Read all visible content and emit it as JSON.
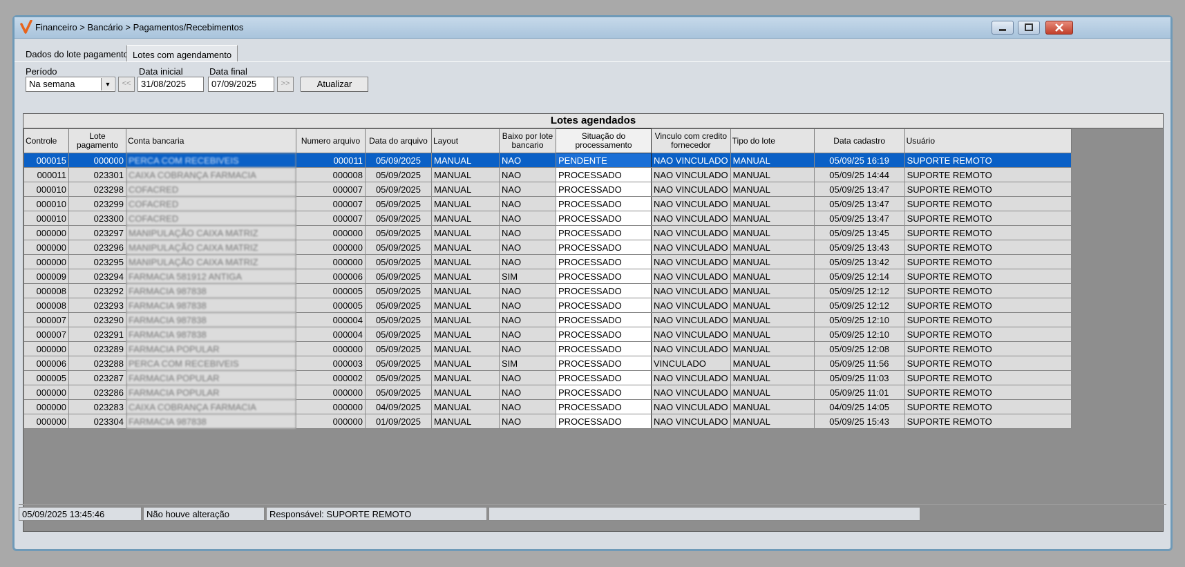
{
  "window": {
    "title": "Financeiro > Bancário > Pagamentos/Recebimentos"
  },
  "tabs": [
    {
      "label": "Dados do lote pagamento"
    },
    {
      "label": "Lotes com agendamento"
    }
  ],
  "filters": {
    "periodo_label": "Período",
    "periodo_value": "Na semana",
    "data_inicial_label": "Data inicial",
    "data_inicial_value": "31/08/2025",
    "data_final_label": "Data final",
    "data_final_value": "07/09/2025",
    "prev_label": "<<",
    "next_label": ">>",
    "atualizar_label": "Atualizar"
  },
  "grid": {
    "caption": "Lotes agendados",
    "columns": [
      "Controle",
      "Lote pagamento",
      "Conta bancaria",
      "Numero arquivo",
      "Data do arquivo",
      "Layout",
      "Baixo por lote bancario",
      "Situação do processamento",
      "Vinculo com credito fornecedor",
      "Tipo do lote",
      "Data cadastro",
      "Usuário"
    ],
    "rows": [
      [
        "000015",
        "000000",
        "PERCA COM RECEBIVEIS",
        "000011",
        "05/09/2025",
        "MANUAL",
        "NAO",
        "PENDENTE",
        "NAO VINCULADO",
        "MANUAL",
        "05/09/25 16:19",
        "SUPORTE REMOTO"
      ],
      [
        "000011",
        "023301",
        "CAIXA COBRANÇA FARMACIA",
        "000008",
        "05/09/2025",
        "MANUAL",
        "NAO",
        "PROCESSADO",
        "NAO VINCULADO",
        "MANUAL",
        "05/09/25 14:44",
        "SUPORTE REMOTO"
      ],
      [
        "000010",
        "023298",
        "COFACRED",
        "000007",
        "05/09/2025",
        "MANUAL",
        "NAO",
        "PROCESSADO",
        "NAO VINCULADO",
        "MANUAL",
        "05/09/25 13:47",
        "SUPORTE REMOTO"
      ],
      [
        "000010",
        "023299",
        "COFACRED",
        "000007",
        "05/09/2025",
        "MANUAL",
        "NAO",
        "PROCESSADO",
        "NAO VINCULADO",
        "MANUAL",
        "05/09/25 13:47",
        "SUPORTE REMOTO"
      ],
      [
        "000010",
        "023300",
        "COFACRED",
        "000007",
        "05/09/2025",
        "MANUAL",
        "NAO",
        "PROCESSADO",
        "NAO VINCULADO",
        "MANUAL",
        "05/09/25 13:47",
        "SUPORTE REMOTO"
      ],
      [
        "000000",
        "023297",
        "MANIPULAÇÃO CAIXA MATRIZ",
        "000000",
        "05/09/2025",
        "MANUAL",
        "NAO",
        "PROCESSADO",
        "NAO VINCULADO",
        "MANUAL",
        "05/09/25 13:45",
        "SUPORTE REMOTO"
      ],
      [
        "000000",
        "023296",
        "MANIPULAÇÃO CAIXA MATRIZ",
        "000000",
        "05/09/2025",
        "MANUAL",
        "NAO",
        "PROCESSADO",
        "NAO VINCULADO",
        "MANUAL",
        "05/09/25 13:43",
        "SUPORTE REMOTO"
      ],
      [
        "000000",
        "023295",
        "MANIPULAÇÃO CAIXA MATRIZ",
        "000000",
        "05/09/2025",
        "MANUAL",
        "NAO",
        "PROCESSADO",
        "NAO VINCULADO",
        "MANUAL",
        "05/09/25 13:42",
        "SUPORTE REMOTO"
      ],
      [
        "000009",
        "023294",
        "FARMACIA 581912 ANTIGA",
        "000006",
        "05/09/2025",
        "MANUAL",
        "SIM",
        "PROCESSADO",
        "NAO VINCULADO",
        "MANUAL",
        "05/09/25 12:14",
        "SUPORTE REMOTO"
      ],
      [
        "000008",
        "023292",
        "FARMACIA 987838",
        "000005",
        "05/09/2025",
        "MANUAL",
        "NAO",
        "PROCESSADO",
        "NAO VINCULADO",
        "MANUAL",
        "05/09/25 12:12",
        "SUPORTE REMOTO"
      ],
      [
        "000008",
        "023293",
        "FARMACIA 987838",
        "000005",
        "05/09/2025",
        "MANUAL",
        "NAO",
        "PROCESSADO",
        "NAO VINCULADO",
        "MANUAL",
        "05/09/25 12:12",
        "SUPORTE REMOTO"
      ],
      [
        "000007",
        "023290",
        "FARMACIA 987838",
        "000004",
        "05/09/2025",
        "MANUAL",
        "NAO",
        "PROCESSADO",
        "NAO VINCULADO",
        "MANUAL",
        "05/09/25 12:10",
        "SUPORTE REMOTO"
      ],
      [
        "000007",
        "023291",
        "FARMACIA 987838",
        "000004",
        "05/09/2025",
        "MANUAL",
        "NAO",
        "PROCESSADO",
        "NAO VINCULADO",
        "MANUAL",
        "05/09/25 12:10",
        "SUPORTE REMOTO"
      ],
      [
        "000000",
        "023289",
        "FARMACIA POPULAR",
        "000000",
        "05/09/2025",
        "MANUAL",
        "NAO",
        "PROCESSADO",
        "NAO VINCULADO",
        "MANUAL",
        "05/09/25 12:08",
        "SUPORTE REMOTO"
      ],
      [
        "000006",
        "023288",
        "PERCA COM RECEBIVEIS",
        "000003",
        "05/09/2025",
        "MANUAL",
        "SIM",
        "PROCESSADO",
        "VINCULADO",
        "MANUAL",
        "05/09/25 11:56",
        "SUPORTE REMOTO"
      ],
      [
        "000005",
        "023287",
        "FARMACIA POPULAR",
        "000002",
        "05/09/2025",
        "MANUAL",
        "NAO",
        "PROCESSADO",
        "NAO VINCULADO",
        "MANUAL",
        "05/09/25 11:03",
        "SUPORTE REMOTO"
      ],
      [
        "000000",
        "023286",
        "FARMACIA POPULAR",
        "000000",
        "05/09/2025",
        "MANUAL",
        "NAO",
        "PROCESSADO",
        "NAO VINCULADO",
        "MANUAL",
        "05/09/25 11:01",
        "SUPORTE REMOTO"
      ],
      [
        "000000",
        "023283",
        "CAIXA COBRANÇA FARMACIA",
        "000000",
        "04/09/2025",
        "MANUAL",
        "NAO",
        "PROCESSADO",
        "NAO VINCULADO",
        "MANUAL",
        "04/09/25 14:05",
        "SUPORTE REMOTO"
      ],
      [
        "000000",
        "023304",
        "FARMACIA 987838",
        "000000",
        "01/09/2025",
        "MANUAL",
        "NAO",
        "PROCESSADO",
        "NAO VINCULADO",
        "MANUAL",
        "05/09/25 15:43",
        "SUPORTE REMOTO"
      ]
    ]
  },
  "status": {
    "datetime": "05/09/2025 13:45:46",
    "message": "Não houve alteração",
    "responsavel": "Responsável: SUPORTE REMOTO"
  },
  "colors": {
    "selection": "#0a60c6",
    "title_bar": "#b7cfe4",
    "close_button": "#c0402b",
    "logo": "#e8641c"
  }
}
